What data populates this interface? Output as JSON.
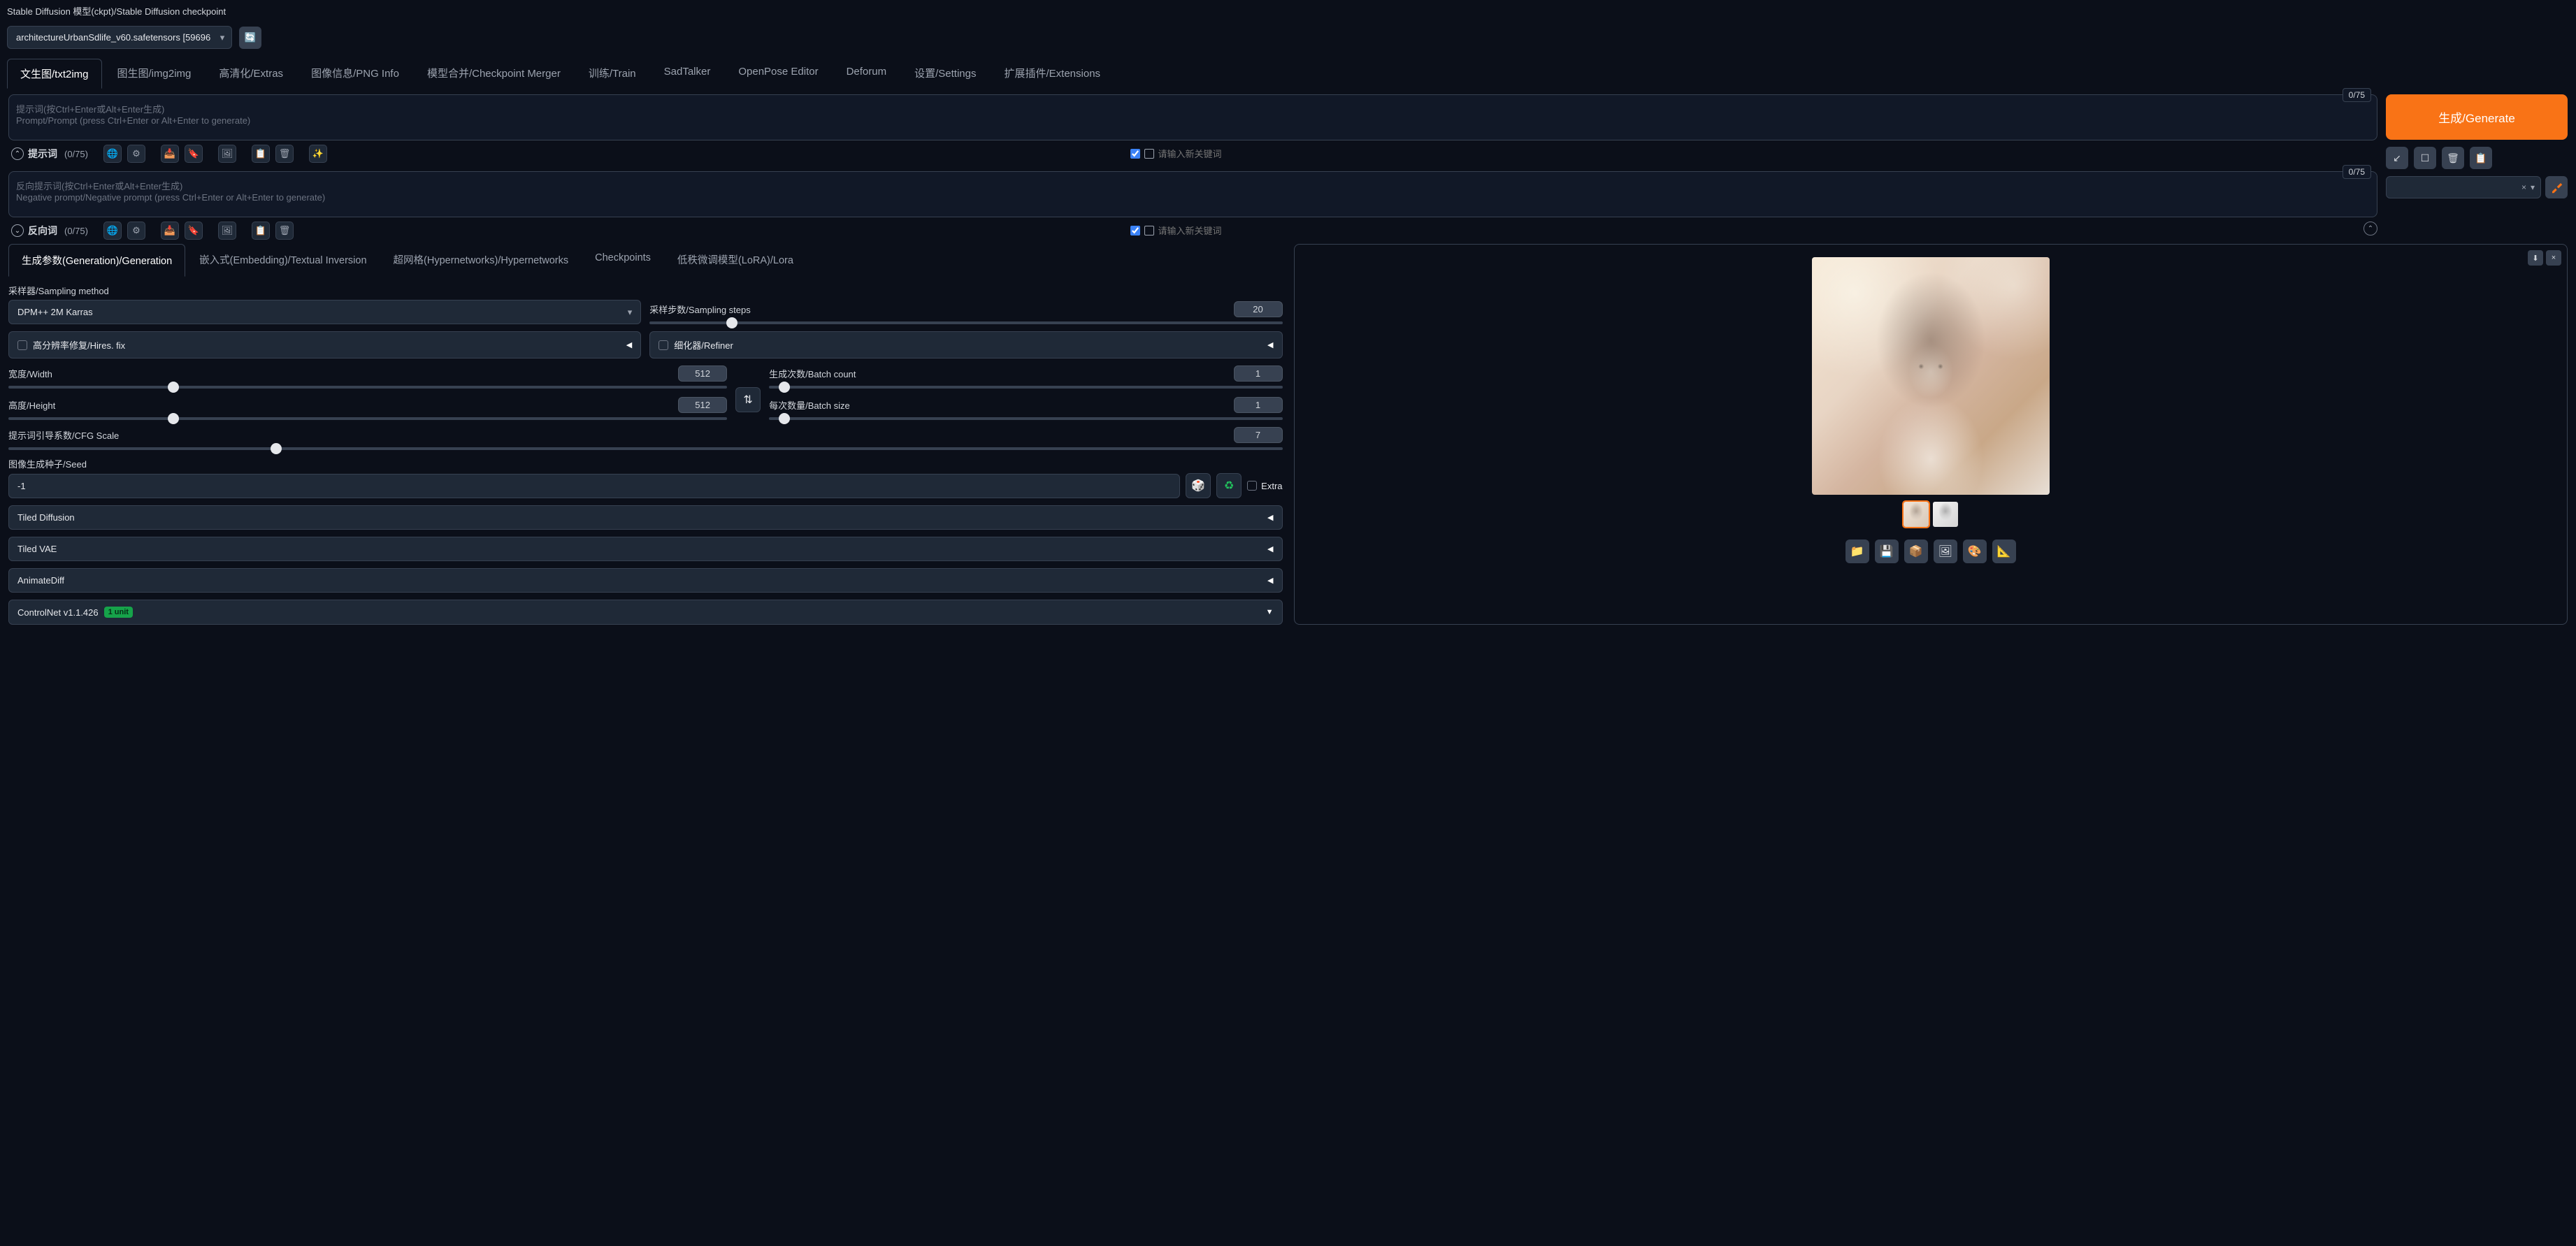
{
  "header": {
    "checkpoint_label": "Stable Diffusion 模型(ckpt)/Stable Diffusion checkpoint",
    "checkpoint_value": "architectureUrbanSdlife_v60.safetensors [59696"
  },
  "tabs": [
    "文生图/txt2img",
    "图生图/img2img",
    "高清化/Extras",
    "图像信息/PNG Info",
    "模型合并/Checkpoint Merger",
    "训练/Train",
    "SadTalker",
    "OpenPose Editor",
    "Deforum",
    "设置/Settings",
    "扩展插件/Extensions"
  ],
  "prompt": {
    "placeholder_line1": "提示词(按Ctrl+Enter或Alt+Enter生成)",
    "placeholder_line2": "Prompt/Prompt (press Ctrl+Enter or Alt+Enter to generate)",
    "token_counter": "0/75",
    "label": "提示词",
    "count": "(0/75)",
    "kw_placeholder": "请输入新关键词"
  },
  "neg_prompt": {
    "placeholder_line1": "反向提示词(按Ctrl+Enter或Alt+Enter生成)",
    "placeholder_line2": "Negative prompt/Negative prompt (press Ctrl+Enter or Alt+Enter to generate)",
    "token_counter": "0/75",
    "label": "反向词",
    "count": "(0/75)",
    "kw_placeholder": "请输入新关键词"
  },
  "generate": {
    "button": "生成/Generate"
  },
  "subtabs": [
    "生成参数(Generation)/Generation",
    "嵌入式(Embedding)/Textual Inversion",
    "超网格(Hypernetworks)/Hypernetworks",
    "Checkpoints",
    "低秩微调模型(LoRA)/Lora"
  ],
  "params": {
    "sampler_label": "采样器/Sampling method",
    "sampler_value": "DPM++ 2M Karras",
    "steps_label": "采样步数/Sampling steps",
    "steps_value": "20",
    "hires_label": "高分辨率修复/Hires. fix",
    "refiner_label": "细化器/Refiner",
    "width_label": "宽度/Width",
    "width_value": "512",
    "height_label": "高度/Height",
    "height_value": "512",
    "batch_count_label": "生成次数/Batch count",
    "batch_count_value": "1",
    "batch_size_label": "每次数量/Batch size",
    "batch_size_value": "1",
    "cfg_label": "提示词引导系数/CFG Scale",
    "cfg_value": "7",
    "seed_label": "图像生成种子/Seed",
    "seed_value": "-1",
    "extra_label": "Extra",
    "accordions": {
      "tiled_diffusion": "Tiled Diffusion",
      "tiled_vae": "Tiled VAE",
      "animatediff": "AnimateDiff",
      "controlnet": "ControlNet v1.1.426",
      "controlnet_badge": "1 unit"
    }
  },
  "icons": {
    "refresh": "🔄",
    "globe": "🌐",
    "gear": "⚙",
    "doc_in": "📥",
    "doc_save": "🔖",
    "image": "🖼",
    "copy": "📋",
    "trash": "🗑",
    "sparkle": "✨",
    "arrow_dl": "↙",
    "square": "☐",
    "del": "🗑",
    "clip": "📋",
    "x": "×",
    "dd": "▾",
    "brush": "🖌",
    "swap": "⇅",
    "dice": "🎲",
    "recycle": "♻",
    "folder": "📁",
    "save": "💾",
    "zip": "📦",
    "img": "🖼",
    "palette": "🎨",
    "ruler": "📐",
    "dl": "⬇",
    "close": "×"
  }
}
